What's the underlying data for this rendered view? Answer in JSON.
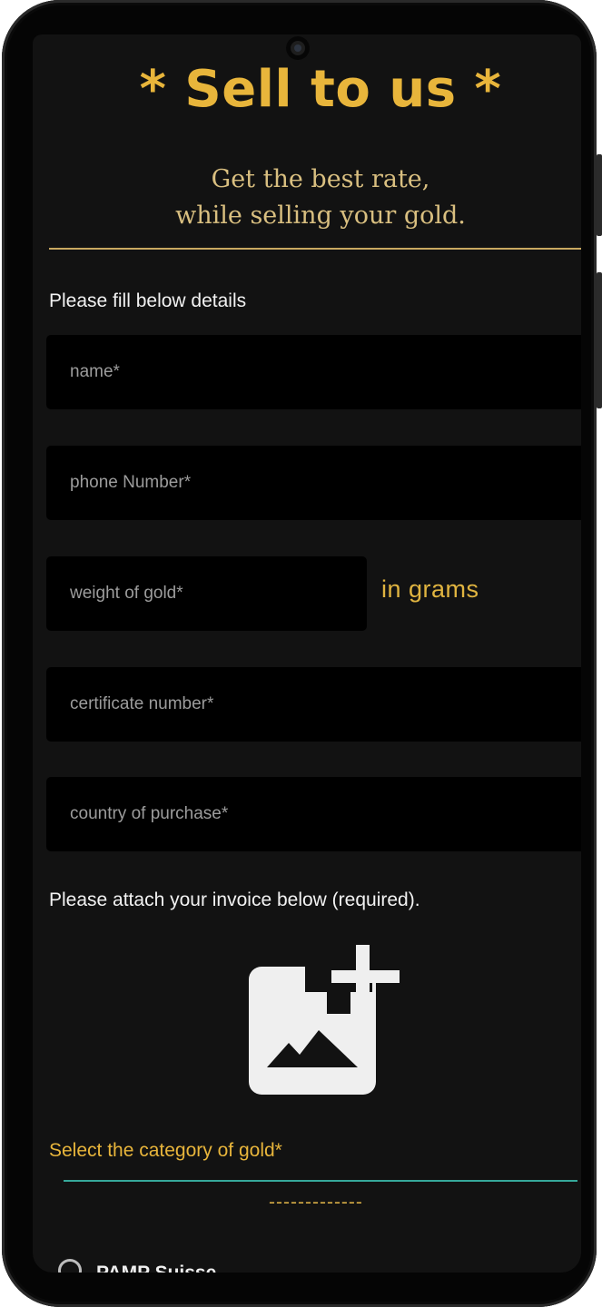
{
  "header": {
    "title": "* Sell to us *",
    "subtitle_line1": "Get the best rate,",
    "subtitle_line2": "while selling your gold."
  },
  "form": {
    "instructions": "Please fill below details",
    "fields": {
      "name_placeholder": "name*",
      "phone_placeholder": "phone Number*",
      "weight_placeholder": "weight of gold*",
      "weight_unit": "in grams",
      "certificate_placeholder": "certificate number*",
      "country_placeholder": "country of purchase*"
    },
    "attach_instructions": "Please attach your invoice below (required).",
    "attach_icon": "add-image-icon",
    "category_label": "Select the category of gold*",
    "category_selected": "-------------",
    "category_options": [
      "PAMP Suisse"
    ]
  },
  "colors": {
    "accent_gold": "#e8b53b",
    "subtitle_gold": "#d9bf80",
    "background": "#121212",
    "field_bg": "#000000",
    "underline_teal": "#36a89a"
  }
}
